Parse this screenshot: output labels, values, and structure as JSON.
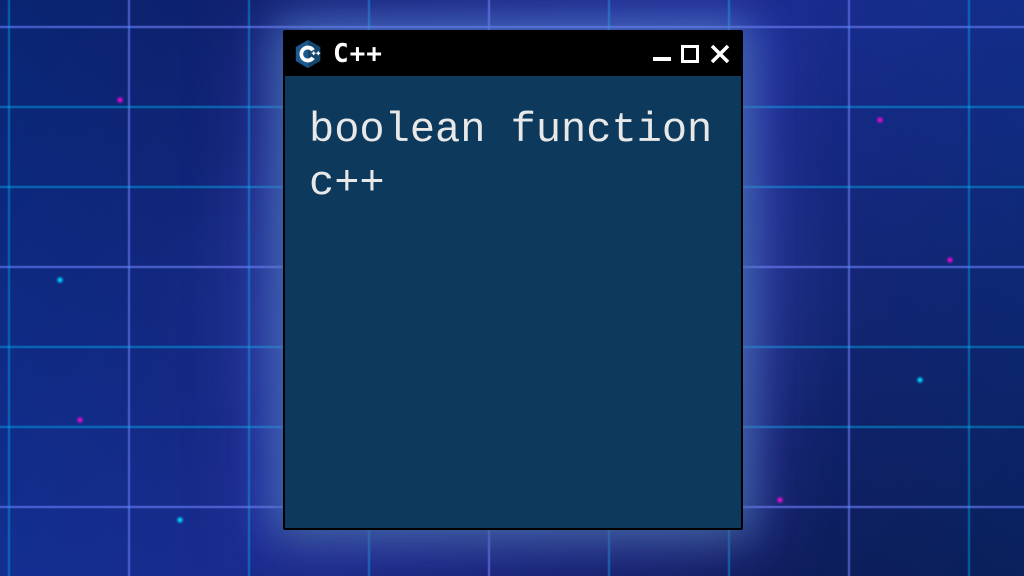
{
  "window": {
    "title": "C++",
    "icon_name": "cpp-logo",
    "content_text": "boolean function c++"
  },
  "controls": {
    "minimize_label": "Minimize",
    "maximize_label": "Maximize",
    "close_label": "Close"
  },
  "colors": {
    "titlebar_bg": "#000000",
    "window_bg": "#0d3a5c",
    "text": "#e8e8e8",
    "cpp_badge": "#1b598e"
  }
}
